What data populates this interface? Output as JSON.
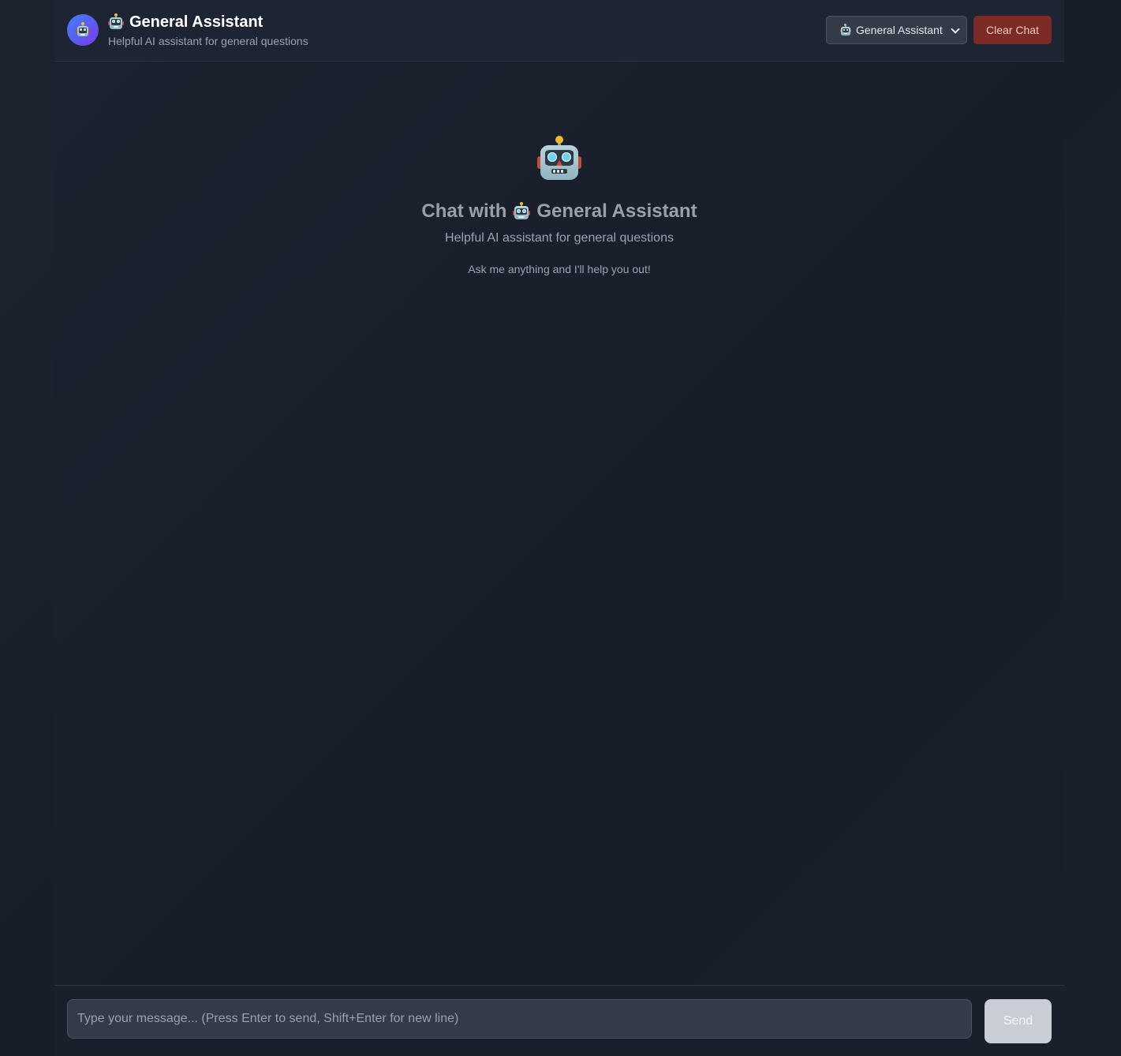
{
  "header": {
    "title": "General Assistant",
    "subtitle": "Helpful AI assistant for general questions",
    "assistant_select": {
      "selected": "General Assistant",
      "icon": "robot-icon"
    },
    "clear_label": "Clear Chat"
  },
  "empty_state": {
    "icon": "robot-icon",
    "title_prefix": "Chat with",
    "title_name": "General Assistant",
    "subtitle": "Helpful AI assistant for general questions",
    "hint": "Ask me anything and I'll help you out!"
  },
  "composer": {
    "placeholder": "Type your message... (Press Enter to send, Shift+Enter for new line)",
    "value": "",
    "send_label": "Send"
  },
  "colors": {
    "background": "#181e29",
    "header": "#1e2532",
    "avatar_gradient_start": "#3b82f6",
    "avatar_gradient_end": "#7c3aed",
    "clear_button": "#7c2a25",
    "send_button": "#c9ced6"
  }
}
